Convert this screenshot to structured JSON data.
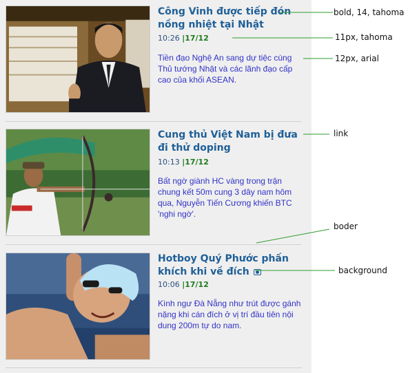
{
  "articles": [
    {
      "title": "Công Vinh được tiếp đón nồng nhiệt tại Nhật",
      "time": "10:26",
      "separator": "|",
      "date": "17/12",
      "description": "Tiền đạo Nghệ An sang dự tiệc cùng Thủ tướng Nhật và các lãnh đạo cấp cao của khối ASEAN.",
      "image": "player-in-suit-thumbs-up-photo"
    },
    {
      "title": "Cung thủ Việt Nam bị đưa đi thử doping",
      "time": "10:13",
      "separator": "|",
      "date": "17/12",
      "description": "Bất ngờ giành HC vàng trong trận chung kết 50m cung 3 dây nam hôm qua, Nguyễn Tiến Cương khiến BTC 'nghi ngờ'.",
      "image": "archer-aiming-bow-photo"
    },
    {
      "title": "Hotboy Quý Phước phấn khích khi về đích",
      "time": "10:06",
      "separator": "|",
      "date": "17/12",
      "description": "Kình ngư Đà Nẵng như trút được gánh nặng khi cán đích ở vị trí đầu tiên nội dung 200m tự do nam.",
      "image": "swimmer-celebrating-photo",
      "has_camera_icon": true
    }
  ],
  "annotations": {
    "title_font": "bold, 14, tahoma",
    "meta_font": "11px, tahoma",
    "desc_font": "12px, arial",
    "link": "link",
    "border": "boder",
    "background": "background"
  },
  "colors": {
    "title": "#1f5f97",
    "date": "#1f7a1f",
    "description": "#3232c8",
    "panel_background": "#efefef",
    "annotation_line": "#2e9c2e"
  }
}
